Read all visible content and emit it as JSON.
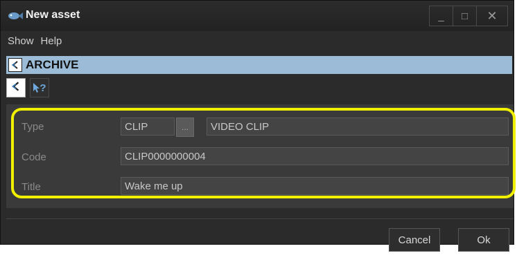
{
  "window": {
    "title": "New asset",
    "controls": {
      "minimize": "_",
      "maximize": "□",
      "close": "✕"
    }
  },
  "menu": {
    "items": [
      "Show",
      "Help"
    ]
  },
  "breadcrumb": {
    "label": "ARCHIVE",
    "icon": "archive-icon"
  },
  "toolbar": {
    "icons": [
      "archive-icon",
      "help-pointer-icon"
    ],
    "help_glyph": "?"
  },
  "form": {
    "type": {
      "label": "Type",
      "code": "CLIP",
      "browse_label": "...",
      "description": "VIDEO CLIP"
    },
    "code": {
      "label": "Code",
      "value": "CLIP0000000004"
    },
    "title": {
      "label": "Title",
      "value": "Wake me up"
    }
  },
  "buttons": {
    "cancel": "Cancel",
    "ok": "Ok"
  },
  "colors": {
    "highlight": "#f0f000",
    "selection_bar": "#9bbbd6",
    "background": "#2b2b2b"
  }
}
